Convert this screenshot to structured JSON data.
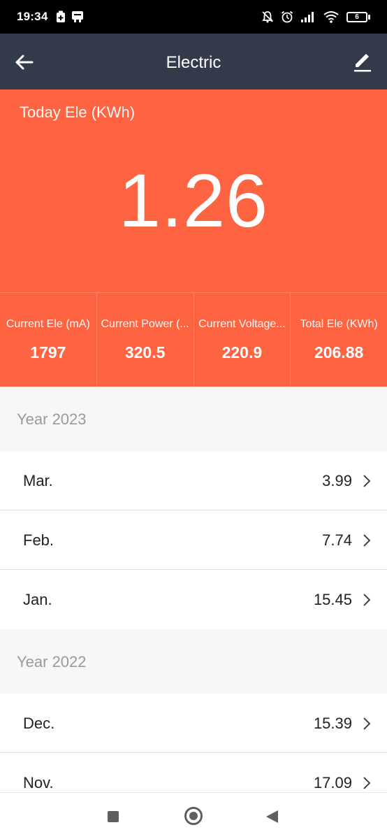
{
  "status_bar": {
    "time": "19:34",
    "battery_level": "6",
    "icons": [
      "battery-saver-icon",
      "notification-app-icon",
      "mute-bell-icon",
      "alarm-icon",
      "signal-icon",
      "wifi-icon",
      "battery-icon"
    ]
  },
  "app_bar": {
    "title": "Electric",
    "back_icon": "back-arrow-icon",
    "edit_icon": "pencil-edit-icon",
    "background": "#333b4b"
  },
  "hero": {
    "label": "Today Ele (KWh)",
    "value": "1.26",
    "background": "#ff6442"
  },
  "stats": [
    {
      "label": "Current Ele (mA)",
      "value": "1797"
    },
    {
      "label": "Current Power (...",
      "value": "320.5"
    },
    {
      "label": "Current Voltage...",
      "value": "220.9"
    },
    {
      "label": "Total Ele (KWh)",
      "value": "206.88"
    }
  ],
  "sections": [
    {
      "title": "Year 2023",
      "rows": [
        {
          "month": "Mar.",
          "value": "3.99"
        },
        {
          "month": "Feb.",
          "value": "7.74"
        },
        {
          "month": "Jan.",
          "value": "15.45"
        }
      ]
    },
    {
      "title": "Year 2022",
      "rows": [
        {
          "month": "Dec.",
          "value": "15.39"
        },
        {
          "month": "Nov.",
          "value": "17.09"
        }
      ]
    }
  ],
  "nav_bar": {
    "icons": [
      "recents-square-icon",
      "home-circle-icon",
      "back-triangle-icon"
    ]
  }
}
